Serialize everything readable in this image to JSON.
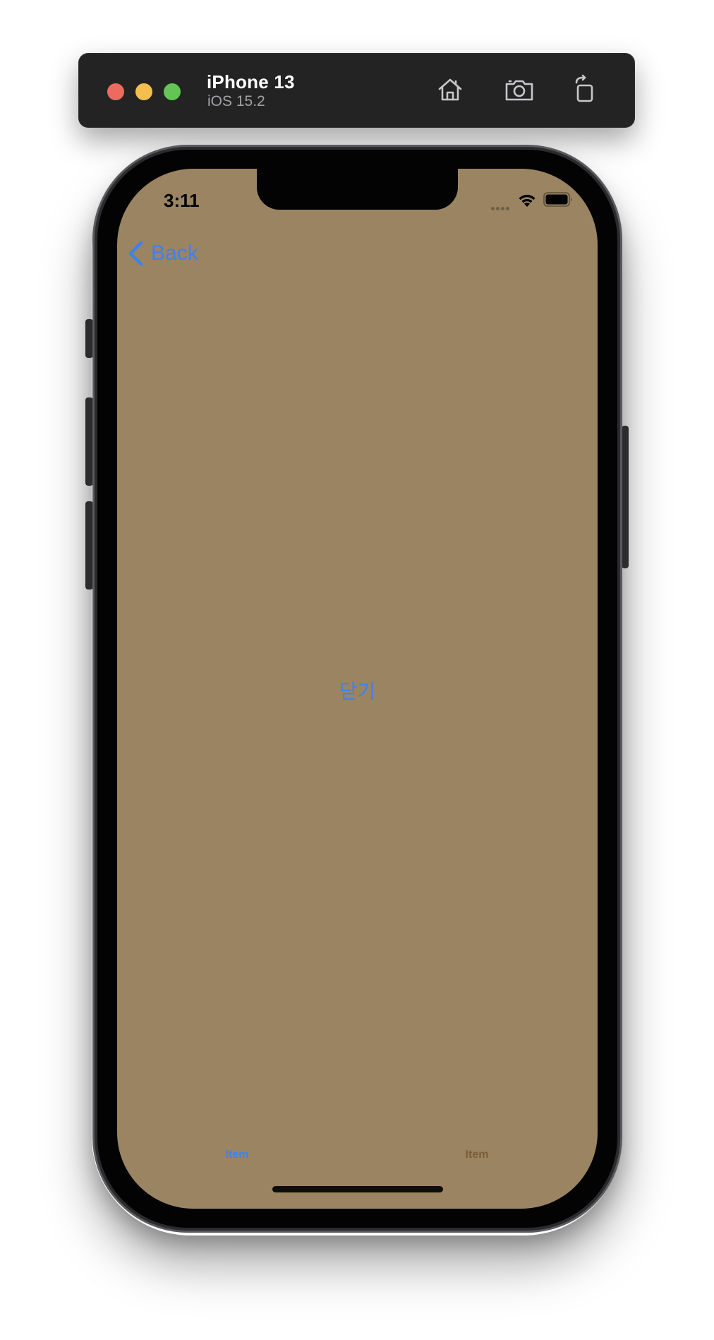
{
  "simulator": {
    "device_name": "iPhone 13",
    "os_version": "iOS 15.2",
    "traffic_lights": [
      "close",
      "minimize",
      "zoom"
    ],
    "toolbar_icons": [
      "home-icon",
      "screenshot-icon",
      "rotate-icon"
    ]
  },
  "status_bar": {
    "time": "3:11",
    "icons": [
      "signal-dots-icon",
      "wifi-icon",
      "battery-icon"
    ]
  },
  "navigation": {
    "back_label": "Back"
  },
  "content": {
    "center_button_label": "닫기",
    "background_color": "#9b8462",
    "accent_color": "#3c82f0"
  },
  "tab_bar": {
    "items": [
      {
        "label": "Item",
        "selected": true,
        "color": "#3c82f0"
      },
      {
        "label": "Item",
        "selected": false,
        "color": "#7a5f38"
      }
    ]
  }
}
